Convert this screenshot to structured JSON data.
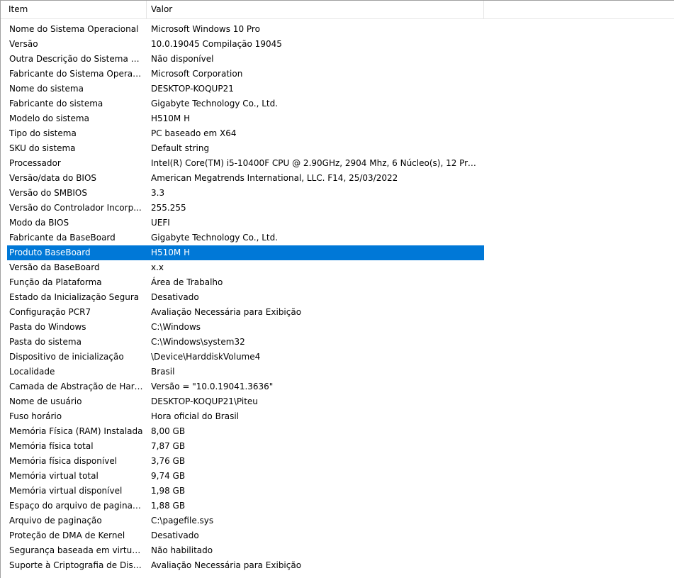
{
  "columns": {
    "item": "Item",
    "valor": "Valor"
  },
  "colors": {
    "selection": "#0078d7",
    "selection_text": "#ffffff"
  },
  "selected_row": 15,
  "rows": [
    {
      "item": "Nome do Sistema Operacional",
      "valor": "Microsoft Windows 10 Pro"
    },
    {
      "item": "Versão",
      "valor": "10.0.19045 Compilação 19045"
    },
    {
      "item": "Outra Descrição do Sistema O...",
      "valor": "Não disponível"
    },
    {
      "item": "Fabricante do Sistema Operaci...",
      "valor": "Microsoft Corporation"
    },
    {
      "item": "Nome do sistema",
      "valor": "DESKTOP-KOQUP21"
    },
    {
      "item": "Fabricante do sistema",
      "valor": "Gigabyte Technology Co., Ltd."
    },
    {
      "item": "Modelo do sistema",
      "valor": "H510M H"
    },
    {
      "item": "Tipo do sistema",
      "valor": "PC baseado em X64"
    },
    {
      "item": "SKU do sistema",
      "valor": "Default string"
    },
    {
      "item": "Processador",
      "valor": "Intel(R) Core(TM) i5-10400F CPU @ 2.90GHz, 2904 Mhz, 6 Núcleo(s), 12 Proce..."
    },
    {
      "item": "Versão/data do BIOS",
      "valor": "American Megatrends International, LLC. F14, 25/03/2022"
    },
    {
      "item": "Versão do SMBIOS",
      "valor": "3.3"
    },
    {
      "item": "Versão do Controlador Incorp...",
      "valor": "255.255"
    },
    {
      "item": "Modo da BIOS",
      "valor": "UEFI"
    },
    {
      "item": "Fabricante da BaseBoard",
      "valor": "Gigabyte Technology Co., Ltd."
    },
    {
      "item": "Produto BaseBoard",
      "valor": "H510M H"
    },
    {
      "item": "Versão da BaseBoard",
      "valor": "x.x"
    },
    {
      "item": "Função da Plataforma",
      "valor": "Área de Trabalho"
    },
    {
      "item": "Estado da Inicialização Segura",
      "valor": "Desativado"
    },
    {
      "item": "Configuração PCR7",
      "valor": "Avaliação Necessária para Exibição"
    },
    {
      "item": "Pasta do Windows",
      "valor": "C:\\Windows"
    },
    {
      "item": "Pasta do sistema",
      "valor": "C:\\Windows\\system32"
    },
    {
      "item": "Dispositivo de inicialização",
      "valor": "\\Device\\HarddiskVolume4"
    },
    {
      "item": "Localidade",
      "valor": "Brasil"
    },
    {
      "item": "Camada de Abstração de Hard...",
      "valor": "Versão = \"10.0.19041.3636\""
    },
    {
      "item": "Nome de usuário",
      "valor": "DESKTOP-KOQUP21\\Piteu"
    },
    {
      "item": "Fuso horário",
      "valor": "Hora oficial do Brasil"
    },
    {
      "item": "Memória Física (RAM) Instalada",
      "valor": "8,00 GB"
    },
    {
      "item": "Memória física total",
      "valor": "7,87 GB"
    },
    {
      "item": "Memória física disponível",
      "valor": "3,76 GB"
    },
    {
      "item": "Memória virtual total",
      "valor": "9,74 GB"
    },
    {
      "item": "Memória virtual disponível",
      "valor": "1,98 GB"
    },
    {
      "item": "Espaço do arquivo de paginaç...",
      "valor": "1,88 GB"
    },
    {
      "item": "Arquivo de paginação",
      "valor": "C:\\pagefile.sys"
    },
    {
      "item": "Proteção de DMA de Kernel",
      "valor": "Desativado"
    },
    {
      "item": "Segurança baseada em virtuali...",
      "valor": "Não habilitado"
    },
    {
      "item": "Suporte à Criptografia de Disp...",
      "valor": "Avaliação Necessária para Exibição"
    }
  ]
}
